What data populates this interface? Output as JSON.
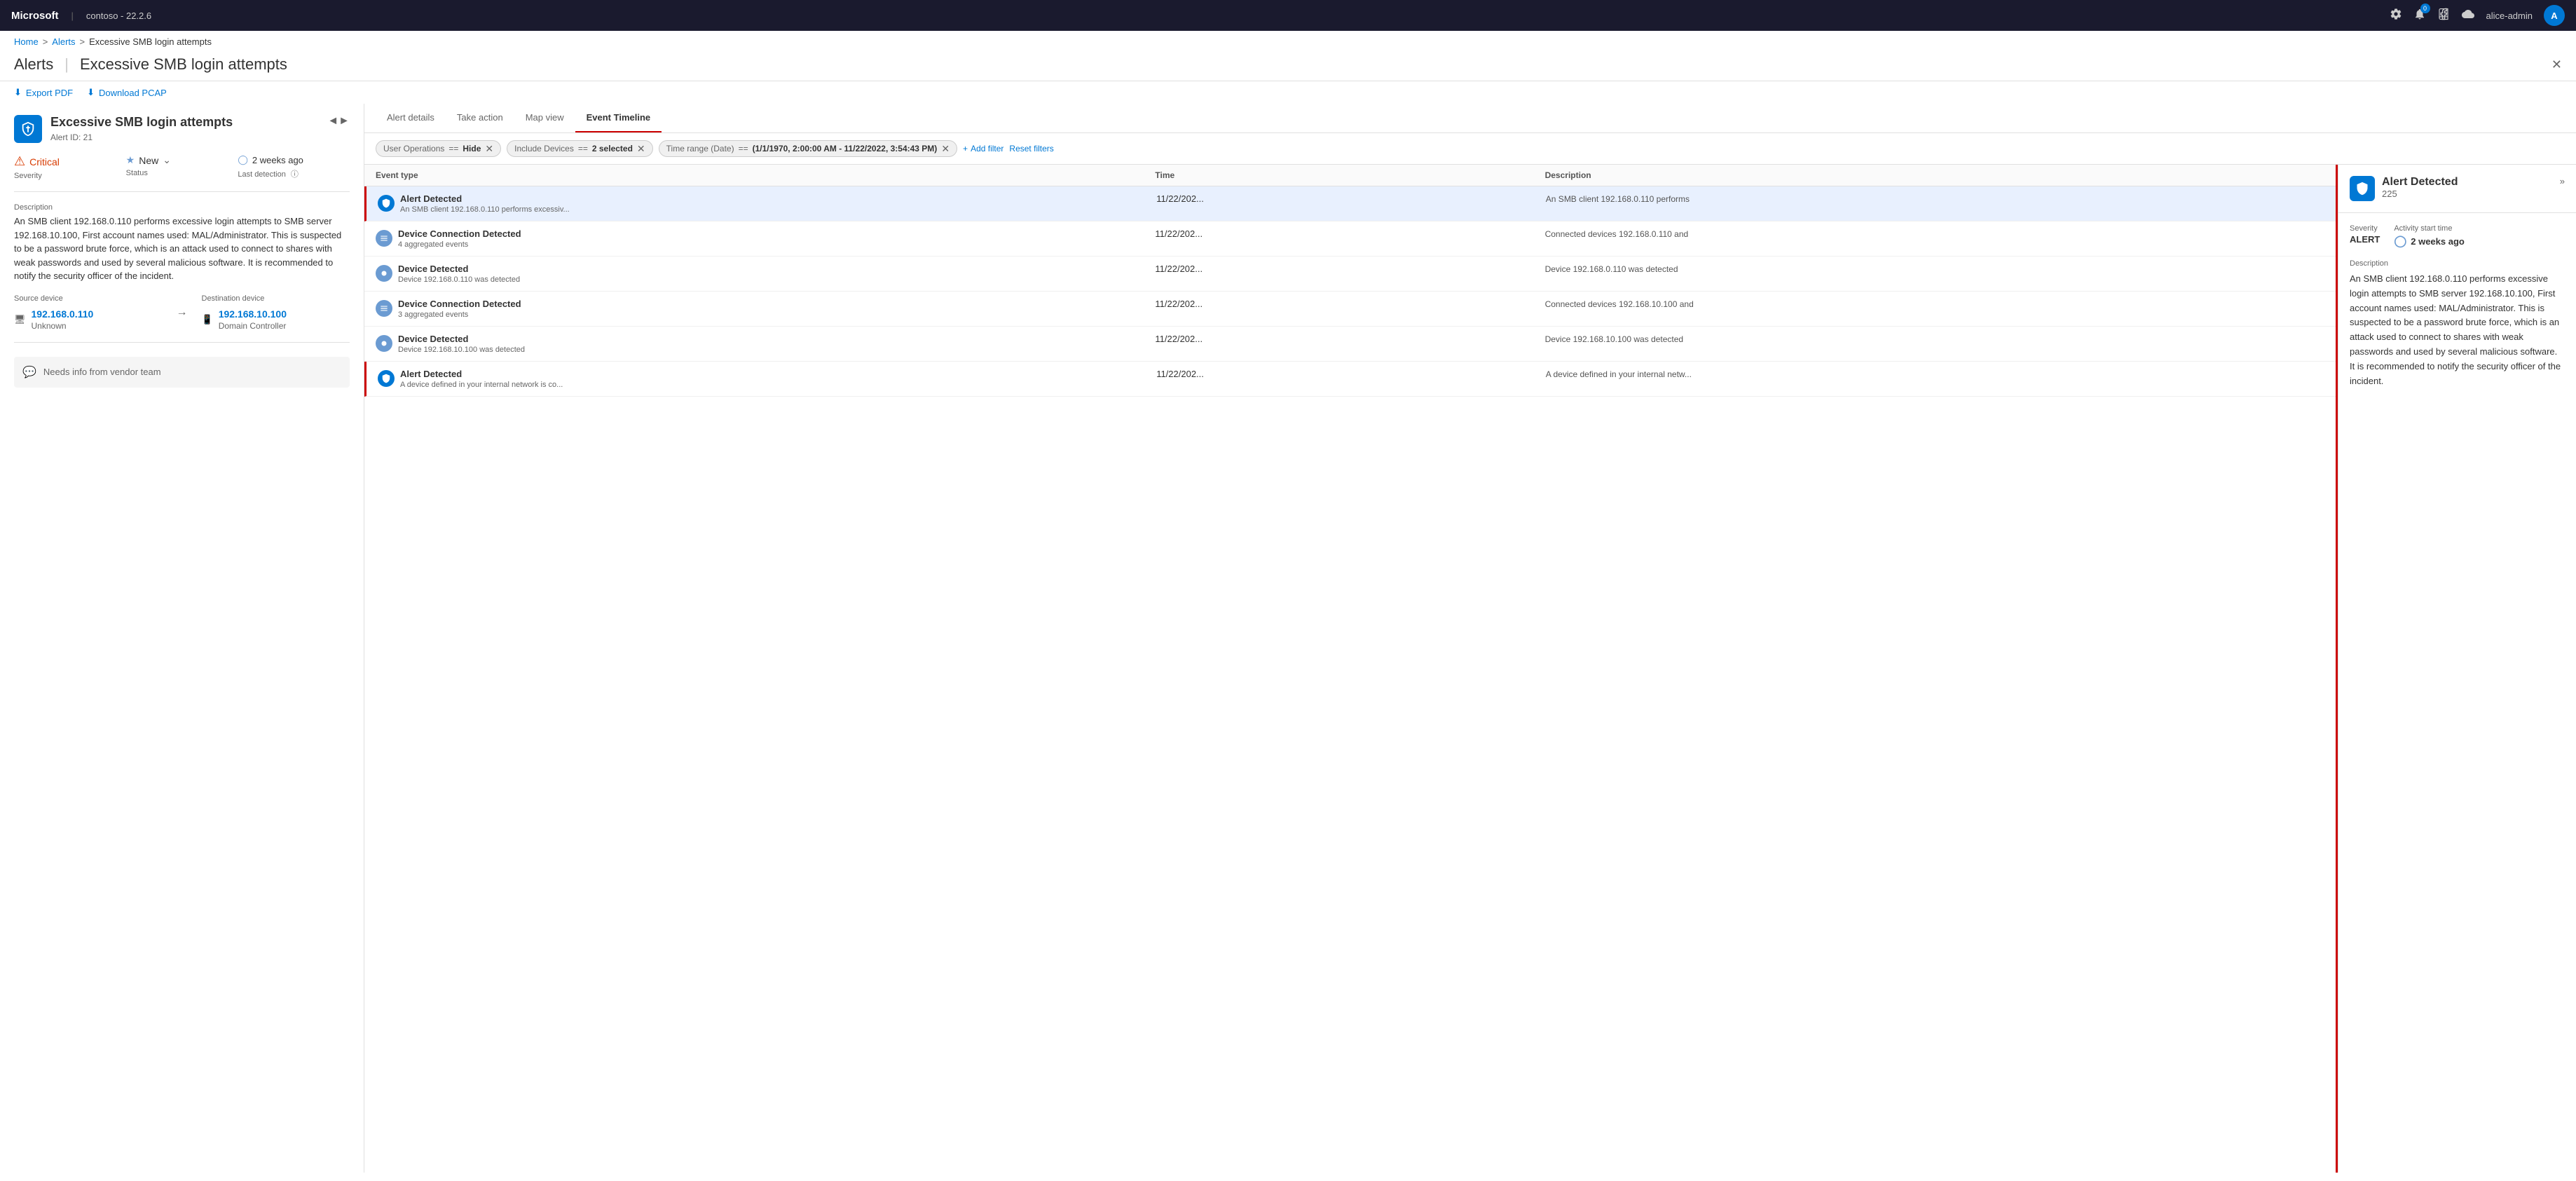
{
  "topnav": {
    "brand": "Microsoft",
    "separator": "|",
    "tenant": "contoso - 22.2.6",
    "notification_count": "0",
    "username": "alice-admin",
    "user_initial": "A"
  },
  "breadcrumb": {
    "home": "Home",
    "alerts": "Alerts",
    "current": "Excessive SMB login attempts"
  },
  "page_header": {
    "title": "Alerts",
    "separator": "|",
    "subtitle": "Excessive SMB login attempts"
  },
  "toolbar": {
    "export_pdf": "Export PDF",
    "download_pcap": "Download PCAP"
  },
  "alert": {
    "title": "Excessive SMB login attempts",
    "alert_id": "Alert ID: 21",
    "severity_label": "Severity",
    "severity_value": "Critical",
    "status_label": "Status",
    "status_value": "New",
    "detection_label": "Last detection",
    "detection_value": "2 weeks ago",
    "description_label": "Description",
    "description_text": "An SMB client 192.168.0.110 performs excessive login attempts to SMB server 192.168.10.100, First account names used: MAL/Administrator. This is suspected to be a password brute force, which is an attack used to connect to shares with weak passwords and used by several malicious software. It is recommended to notify the security officer of the incident.",
    "source_device_label": "Source device",
    "source_device_ip": "192.168.0.110",
    "source_device_type": "Unknown",
    "dest_device_label": "Destination device",
    "dest_device_ip": "192.168.10.100",
    "dest_device_type": "Domain Controller",
    "comment": "Needs info from vendor team"
  },
  "tabs": [
    {
      "label": "Alert details",
      "active": false
    },
    {
      "label": "Take action",
      "active": false
    },
    {
      "label": "Map view",
      "active": false
    },
    {
      "label": "Event Timeline",
      "active": true
    }
  ],
  "filters": [
    {
      "key": "User Operations",
      "op": "==",
      "value": "Hide"
    },
    {
      "key": "Include Devices",
      "op": "==",
      "value": "2 selected"
    },
    {
      "key": "Time range (Date)",
      "op": "==",
      "value": "(1/1/1970, 2:00:00 AM - 11/22/2022, 3:54:43 PM)"
    }
  ],
  "add_filter_label": "Add filter",
  "reset_filters_label": "Reset filters",
  "table_headers": {
    "event_type": "Event type",
    "time": "Time",
    "description": "Description"
  },
  "events": [
    {
      "type": "Alert Detected",
      "sub": "An SMB client 192.168.0.110 performs excessiv...",
      "time": "11/22/202...",
      "description": "An SMB client 192.168.0.110 performs",
      "icon_type": "alert",
      "is_alert": true,
      "selected": true
    },
    {
      "type": "Device Connection Detected",
      "sub": "4 aggregated events",
      "time": "11/22/202...",
      "description": "Connected devices 192.168.0.110 and",
      "icon_type": "device",
      "is_alert": false,
      "selected": false
    },
    {
      "type": "Device Detected",
      "sub": "Device 192.168.0.110 was detected",
      "time": "11/22/202...",
      "description": "Device 192.168.0.110 was detected",
      "icon_type": "device",
      "is_alert": false,
      "selected": false
    },
    {
      "type": "Device Connection Detected",
      "sub": "3 aggregated events",
      "time": "11/22/202...",
      "description": "Connected devices 192.168.10.100 and",
      "icon_type": "device",
      "is_alert": false,
      "selected": false
    },
    {
      "type": "Device Detected",
      "sub": "Device 192.168.10.100 was detected",
      "time": "11/22/202...",
      "description": "Device 192.168.10.100 was detected",
      "icon_type": "device",
      "is_alert": false,
      "selected": false
    },
    {
      "type": "Alert Detected",
      "sub": "A device defined in your internal network is co...",
      "time": "11/22/202...",
      "description": "A device defined in your internal netw...",
      "icon_type": "alert",
      "is_alert": true,
      "selected": false
    }
  ],
  "detail": {
    "title": "Alert Detected",
    "count": "225",
    "severity_label": "ALERT",
    "severity_sub": "Severity",
    "time_label": "2 weeks ago",
    "time_sub": "Activity start time",
    "description_label": "Description",
    "description_text": "An SMB client 192.168.0.110 performs excessive login attempts to SMB server 192.168.10.100, First account names used: MAL/Administrator. This is suspected to be a password brute force, which is an attack used to connect to shares with weak passwords and used by several malicious software. It is recommended to notify the security officer of the incident."
  }
}
